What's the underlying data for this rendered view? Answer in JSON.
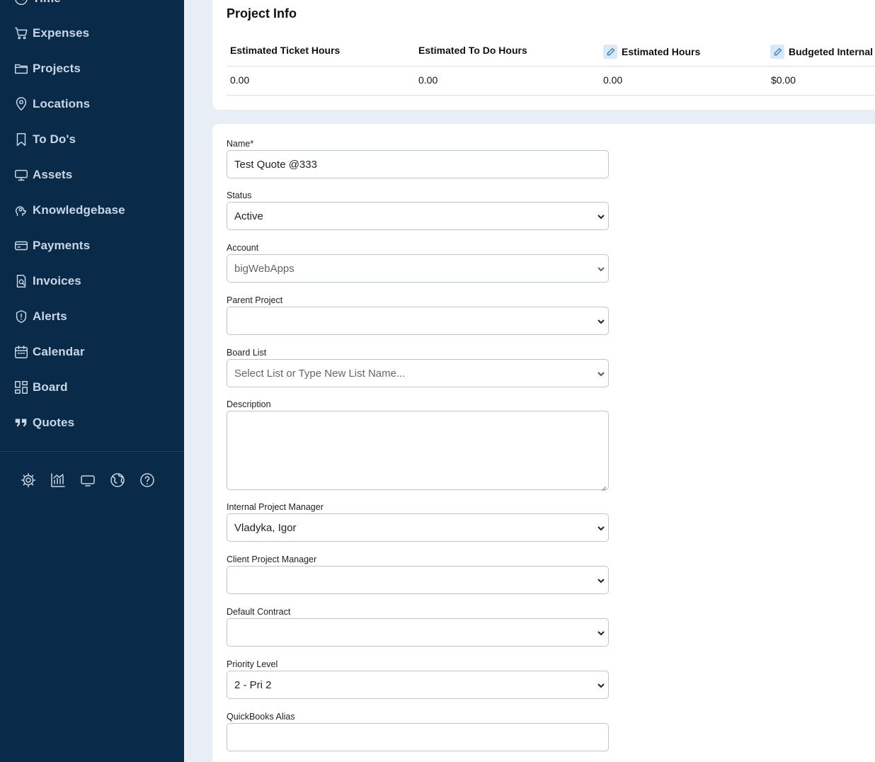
{
  "sidebar": {
    "items": [
      {
        "label": "Time",
        "icon": "clock-icon"
      },
      {
        "label": "Expenses",
        "icon": "cart-icon"
      },
      {
        "label": "Projects",
        "icon": "folder-icon"
      },
      {
        "label": "Locations",
        "icon": "map-pin-icon"
      },
      {
        "label": "To Do's",
        "icon": "bookmark-icon"
      },
      {
        "label": "Assets",
        "icon": "monitor-icon"
      },
      {
        "label": "Knowledgebase",
        "icon": "brain-icon"
      },
      {
        "label": "Payments",
        "icon": "credit-card-icon"
      },
      {
        "label": "Invoices",
        "icon": "invoice-search-icon"
      },
      {
        "label": "Alerts",
        "icon": "shield-alert-icon"
      },
      {
        "label": "Calendar",
        "icon": "calendar-icon"
      },
      {
        "label": "Board",
        "icon": "board-icon"
      },
      {
        "label": "Quotes",
        "icon": "quote-icon"
      }
    ],
    "tools": [
      "settings-icon",
      "chart-icon",
      "display-icon",
      "globe-icon",
      "help-icon"
    ]
  },
  "project_info": {
    "title": "Project Info",
    "columns": [
      "Estimated Ticket Hours",
      "Estimated To Do Hours",
      "Estimated Hours",
      "Budgeted Internal"
    ],
    "values": [
      "0.00",
      "0.00",
      "0.00",
      "$0.00"
    ]
  },
  "form": {
    "name_label": "Name*",
    "name_value": "Test Quote @333",
    "status_label": "Status",
    "status_value": "Active",
    "account_label": "Account",
    "account_value": "bigWebApps",
    "parent_project_label": "Parent Project",
    "parent_project_value": "",
    "board_list_label": "Board List",
    "board_list_placeholder": "Select List or Type New List Name...",
    "description_label": "Description",
    "description_value": "",
    "internal_pm_label": "Internal Project Manager",
    "internal_pm_value": "Vladyka, Igor",
    "client_pm_label": "Client Project Manager",
    "client_pm_value": "",
    "default_contract_label": "Default Contract",
    "default_contract_value": "",
    "priority_label": "Priority Level",
    "priority_value": "2 - Pri 2",
    "quickbooks_label": "QuickBooks Alias",
    "quickbooks_value": ""
  }
}
